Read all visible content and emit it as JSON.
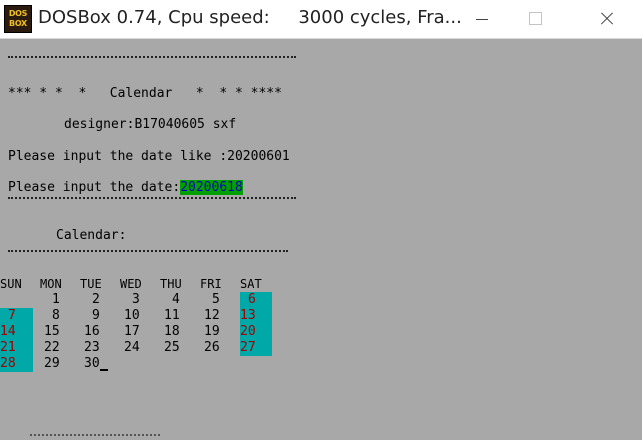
{
  "window": {
    "title": "DOSBox 0.74, Cpu speed:     3000 cycles, Fra...",
    "icon_line1": "DOS",
    "icon_line2": "BOX"
  },
  "console": {
    "banner": "*** * *  *   Calendar   *  * * ****",
    "designer": "designer:B17040605 sxf",
    "prompt_example": "Please input the date like :20200601",
    "prompt_input": "Please input the date:",
    "input_value": "20200618",
    "calendar_heading": "Calendar:"
  },
  "calendar": {
    "weekdays": [
      "SUN",
      "MON",
      "TUE",
      "WED",
      "THU",
      "FRI",
      "SAT"
    ],
    "weeks": [
      [
        "",
        "1",
        "2",
        "3",
        "4",
        "5",
        "6"
      ],
      [
        "7",
        "8",
        "9",
        "10",
        "11",
        "12",
        "13"
      ],
      [
        "14",
        "15",
        "16",
        "17",
        "18",
        "19",
        "20"
      ],
      [
        "21",
        "22",
        "23",
        "24",
        "25",
        "26",
        "27"
      ],
      [
        "28",
        "29",
        "30",
        "",
        "",
        "",
        ""
      ]
    ],
    "weekend_bg": "#00a8a8",
    "weekend_fg": "#a00000"
  },
  "colors": {
    "screen_bg": "#a8a8a8",
    "input_highlight_bg": "#00a000",
    "input_highlight_fg": "#0000c0"
  }
}
